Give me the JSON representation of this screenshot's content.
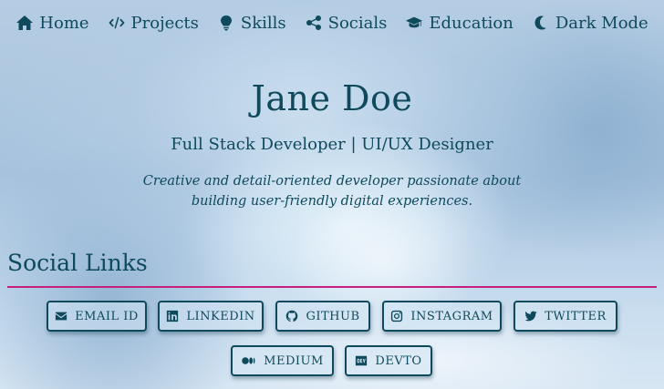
{
  "nav": {
    "items": [
      {
        "label": "Home",
        "icon": "home-icon"
      },
      {
        "label": "Projects",
        "icon": "code-icon"
      },
      {
        "label": "Skills",
        "icon": "lightbulb-icon"
      },
      {
        "label": "Socials",
        "icon": "share-icon"
      },
      {
        "label": "Education",
        "icon": "graduation-cap-icon"
      },
      {
        "label": "Dark Mode",
        "icon": "moon-icon"
      }
    ]
  },
  "hero": {
    "name": "Jane Doe",
    "role": "Full Stack Developer | UI/UX Designer",
    "bio": "Creative and detail-oriented developer passionate about building user-friendly digital experiences."
  },
  "socials": {
    "title": "Social Links",
    "links": [
      {
        "label": "EMAIL ID",
        "icon": "envelope-icon"
      },
      {
        "label": "LINKEDIN",
        "icon": "linkedin-icon"
      },
      {
        "label": "GITHUB",
        "icon": "github-icon"
      },
      {
        "label": "INSTAGRAM",
        "icon": "instagram-icon"
      },
      {
        "label": "TWITTER",
        "icon": "twitter-icon"
      },
      {
        "label": "MEDIUM",
        "icon": "medium-icon"
      },
      {
        "label": "DEVTO",
        "icon": "devto-icon"
      }
    ]
  },
  "colors": {
    "text": "#0e4a5c",
    "divider": "#c6207f"
  }
}
